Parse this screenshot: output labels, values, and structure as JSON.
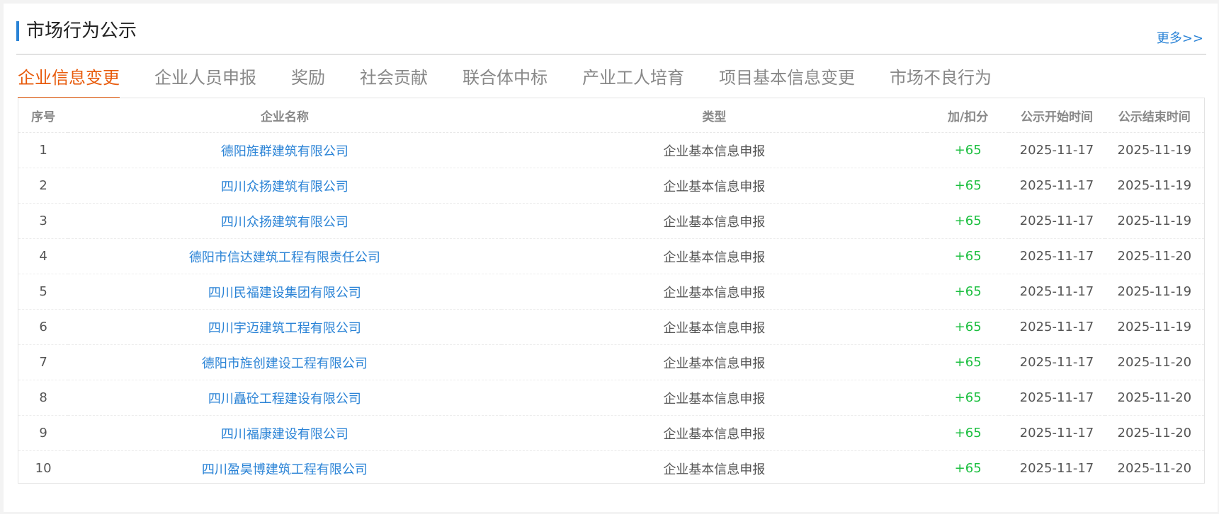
{
  "header": {
    "title": "市场行为公示",
    "more": "更多>>"
  },
  "tabs": [
    "企业信息变更",
    "企业人员申报",
    "奖励",
    "社会贡献",
    "联合体中标",
    "产业工人培育",
    "项目基本信息变更",
    "市场不良行为"
  ],
  "table": {
    "headers": [
      "序号",
      "企业名称",
      "类型",
      "加/扣分",
      "公示开始时间",
      "公示结束时间"
    ],
    "rows": [
      [
        "1",
        "德阳旌群建筑有限公司",
        "企业基本信息申报",
        "+65",
        "2025-11-17",
        "2025-11-19"
      ],
      [
        "2",
        "四川众扬建筑有限公司",
        "企业基本信息申报",
        "+65",
        "2025-11-17",
        "2025-11-19"
      ],
      [
        "3",
        "四川众扬建筑有限公司",
        "企业基本信息申报",
        "+65",
        "2025-11-17",
        "2025-11-19"
      ],
      [
        "4",
        "德阳市信达建筑工程有限责任公司",
        "企业基本信息申报",
        "+65",
        "2025-11-17",
        "2025-11-20"
      ],
      [
        "5",
        "四川民福建设集团有限公司",
        "企业基本信息申报",
        "+65",
        "2025-11-17",
        "2025-11-19"
      ],
      [
        "6",
        "四川宇迈建筑工程有限公司",
        "企业基本信息申报",
        "+65",
        "2025-11-17",
        "2025-11-19"
      ],
      [
        "7",
        "德阳市旌创建设工程有限公司",
        "企业基本信息申报",
        "+65",
        "2025-11-17",
        "2025-11-20"
      ],
      [
        "8",
        "四川矗砼工程建设有限公司",
        "企业基本信息申报",
        "+65",
        "2025-11-17",
        "2025-11-20"
      ],
      [
        "9",
        "四川福康建设有限公司",
        "企业基本信息申报",
        "+65",
        "2025-11-17",
        "2025-11-20"
      ],
      [
        "10",
        "四川盈昊博建筑工程有限公司",
        "企业基本信息申报",
        "+65",
        "2025-11-17",
        "2025-11-20"
      ]
    ]
  },
  "colors": {
    "accent": "#2a83d6",
    "active_tab": "#e85b0c",
    "score_positive": "#1bbf3f"
  }
}
